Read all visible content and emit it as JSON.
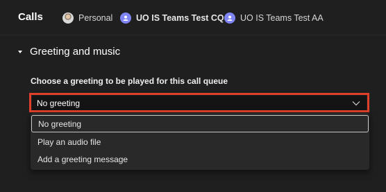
{
  "header": {
    "title": "Calls",
    "accounts": [
      {
        "label": "Personal",
        "icon": "user-avatar-icon"
      },
      {
        "label": "UO IS Teams Test CQ",
        "icon": "call-queue-avatar-icon"
      },
      {
        "label": "UO IS Teams Test AA",
        "icon": "auto-attendant-avatar-icon"
      }
    ]
  },
  "section": {
    "title": "Greeting and music",
    "greeting_label": "Choose a greeting to be played for this call queue",
    "select": {
      "value": "No greeting",
      "options": [
        "No greeting",
        "Play an audio file",
        "Add a greeting message"
      ]
    }
  },
  "colors": {
    "background": "#1f1f1f",
    "highlight": "#e0402b",
    "menu": "#292929",
    "accent_avatar": "#7f85f5"
  }
}
